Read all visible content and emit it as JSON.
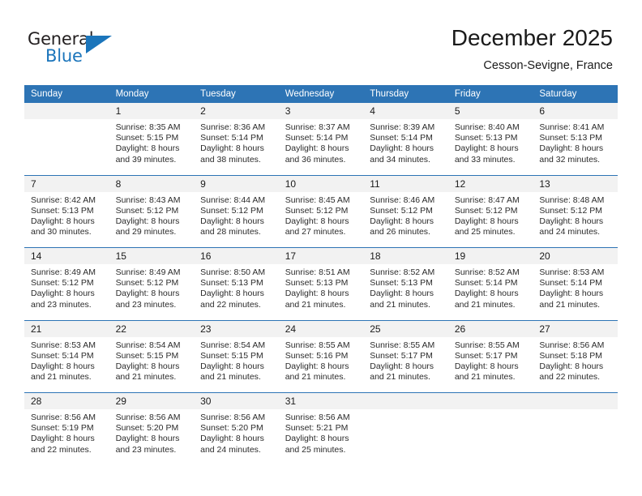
{
  "brand": {
    "name_part1": "General",
    "name_part2": "Blue",
    "accent_color": "#1b75bb"
  },
  "header": {
    "month_title": "December 2025",
    "location": "Cesson-Sevigne, France"
  },
  "theme": {
    "header_row_bg": "#2d74b5",
    "daynum_bg": "#f2f2f2",
    "cell_bg": "#ffffff",
    "text_color": "#2b2b2b"
  },
  "weekday_headers": [
    "Sunday",
    "Monday",
    "Tuesday",
    "Wednesday",
    "Thursday",
    "Friday",
    "Saturday"
  ],
  "weeks": [
    [
      {
        "day": "",
        "lines": []
      },
      {
        "day": "1",
        "lines": [
          "Sunrise: 8:35 AM",
          "Sunset: 5:15 PM",
          "Daylight: 8 hours",
          "and 39 minutes."
        ]
      },
      {
        "day": "2",
        "lines": [
          "Sunrise: 8:36 AM",
          "Sunset: 5:14 PM",
          "Daylight: 8 hours",
          "and 38 minutes."
        ]
      },
      {
        "day": "3",
        "lines": [
          "Sunrise: 8:37 AM",
          "Sunset: 5:14 PM",
          "Daylight: 8 hours",
          "and 36 minutes."
        ]
      },
      {
        "day": "4",
        "lines": [
          "Sunrise: 8:39 AM",
          "Sunset: 5:14 PM",
          "Daylight: 8 hours",
          "and 34 minutes."
        ]
      },
      {
        "day": "5",
        "lines": [
          "Sunrise: 8:40 AM",
          "Sunset: 5:13 PM",
          "Daylight: 8 hours",
          "and 33 minutes."
        ]
      },
      {
        "day": "6",
        "lines": [
          "Sunrise: 8:41 AM",
          "Sunset: 5:13 PM",
          "Daylight: 8 hours",
          "and 32 minutes."
        ]
      }
    ],
    [
      {
        "day": "7",
        "lines": [
          "Sunrise: 8:42 AM",
          "Sunset: 5:13 PM",
          "Daylight: 8 hours",
          "and 30 minutes."
        ]
      },
      {
        "day": "8",
        "lines": [
          "Sunrise: 8:43 AM",
          "Sunset: 5:12 PM",
          "Daylight: 8 hours",
          "and 29 minutes."
        ]
      },
      {
        "day": "9",
        "lines": [
          "Sunrise: 8:44 AM",
          "Sunset: 5:12 PM",
          "Daylight: 8 hours",
          "and 28 minutes."
        ]
      },
      {
        "day": "10",
        "lines": [
          "Sunrise: 8:45 AM",
          "Sunset: 5:12 PM",
          "Daylight: 8 hours",
          "and 27 minutes."
        ]
      },
      {
        "day": "11",
        "lines": [
          "Sunrise: 8:46 AM",
          "Sunset: 5:12 PM",
          "Daylight: 8 hours",
          "and 26 minutes."
        ]
      },
      {
        "day": "12",
        "lines": [
          "Sunrise: 8:47 AM",
          "Sunset: 5:12 PM",
          "Daylight: 8 hours",
          "and 25 minutes."
        ]
      },
      {
        "day": "13",
        "lines": [
          "Sunrise: 8:48 AM",
          "Sunset: 5:12 PM",
          "Daylight: 8 hours",
          "and 24 minutes."
        ]
      }
    ],
    [
      {
        "day": "14",
        "lines": [
          "Sunrise: 8:49 AM",
          "Sunset: 5:12 PM",
          "Daylight: 8 hours",
          "and 23 minutes."
        ]
      },
      {
        "day": "15",
        "lines": [
          "Sunrise: 8:49 AM",
          "Sunset: 5:12 PM",
          "Daylight: 8 hours",
          "and 23 minutes."
        ]
      },
      {
        "day": "16",
        "lines": [
          "Sunrise: 8:50 AM",
          "Sunset: 5:13 PM",
          "Daylight: 8 hours",
          "and 22 minutes."
        ]
      },
      {
        "day": "17",
        "lines": [
          "Sunrise: 8:51 AM",
          "Sunset: 5:13 PM",
          "Daylight: 8 hours",
          "and 21 minutes."
        ]
      },
      {
        "day": "18",
        "lines": [
          "Sunrise: 8:52 AM",
          "Sunset: 5:13 PM",
          "Daylight: 8 hours",
          "and 21 minutes."
        ]
      },
      {
        "day": "19",
        "lines": [
          "Sunrise: 8:52 AM",
          "Sunset: 5:14 PM",
          "Daylight: 8 hours",
          "and 21 minutes."
        ]
      },
      {
        "day": "20",
        "lines": [
          "Sunrise: 8:53 AM",
          "Sunset: 5:14 PM",
          "Daylight: 8 hours",
          "and 21 minutes."
        ]
      }
    ],
    [
      {
        "day": "21",
        "lines": [
          "Sunrise: 8:53 AM",
          "Sunset: 5:14 PM",
          "Daylight: 8 hours",
          "and 21 minutes."
        ]
      },
      {
        "day": "22",
        "lines": [
          "Sunrise: 8:54 AM",
          "Sunset: 5:15 PM",
          "Daylight: 8 hours",
          "and 21 minutes."
        ]
      },
      {
        "day": "23",
        "lines": [
          "Sunrise: 8:54 AM",
          "Sunset: 5:15 PM",
          "Daylight: 8 hours",
          "and 21 minutes."
        ]
      },
      {
        "day": "24",
        "lines": [
          "Sunrise: 8:55 AM",
          "Sunset: 5:16 PM",
          "Daylight: 8 hours",
          "and 21 minutes."
        ]
      },
      {
        "day": "25",
        "lines": [
          "Sunrise: 8:55 AM",
          "Sunset: 5:17 PM",
          "Daylight: 8 hours",
          "and 21 minutes."
        ]
      },
      {
        "day": "26",
        "lines": [
          "Sunrise: 8:55 AM",
          "Sunset: 5:17 PM",
          "Daylight: 8 hours",
          "and 21 minutes."
        ]
      },
      {
        "day": "27",
        "lines": [
          "Sunrise: 8:56 AM",
          "Sunset: 5:18 PM",
          "Daylight: 8 hours",
          "and 22 minutes."
        ]
      }
    ],
    [
      {
        "day": "28",
        "lines": [
          "Sunrise: 8:56 AM",
          "Sunset: 5:19 PM",
          "Daylight: 8 hours",
          "and 22 minutes."
        ]
      },
      {
        "day": "29",
        "lines": [
          "Sunrise: 8:56 AM",
          "Sunset: 5:20 PM",
          "Daylight: 8 hours",
          "and 23 minutes."
        ]
      },
      {
        "day": "30",
        "lines": [
          "Sunrise: 8:56 AM",
          "Sunset: 5:20 PM",
          "Daylight: 8 hours",
          "and 24 minutes."
        ]
      },
      {
        "day": "31",
        "lines": [
          "Sunrise: 8:56 AM",
          "Sunset: 5:21 PM",
          "Daylight: 8 hours",
          "and 25 minutes."
        ]
      },
      {
        "day": "",
        "lines": []
      },
      {
        "day": "",
        "lines": []
      },
      {
        "day": "",
        "lines": []
      }
    ]
  ]
}
